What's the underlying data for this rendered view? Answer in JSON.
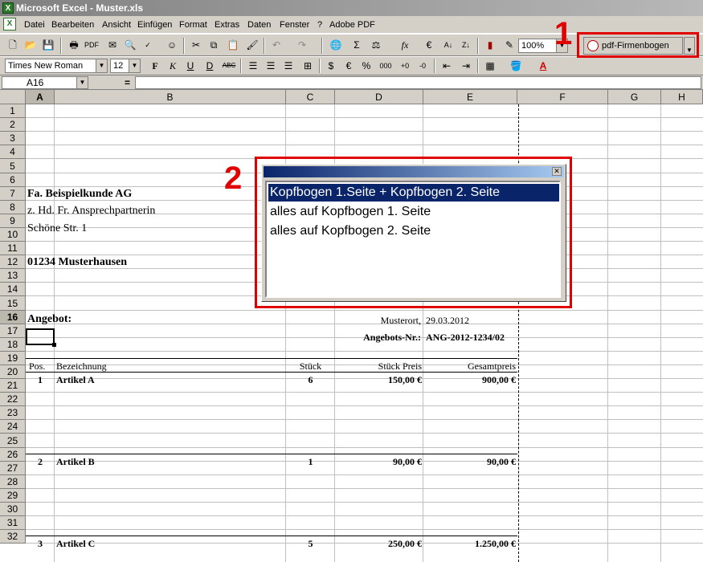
{
  "window": {
    "title": "Microsoft Excel - Muster.xls"
  },
  "menu": [
    "Datei",
    "Bearbeiten",
    "Ansicht",
    "Einfügen",
    "Format",
    "Extras",
    "Daten",
    "Fenster",
    "?",
    "Adobe PDF"
  ],
  "toolbar1": {
    "zoom": "100%",
    "pdf_button": "pdf-Firmenbogen"
  },
  "toolbar2": {
    "font": "Times New Roman",
    "size": "12"
  },
  "formula": {
    "namebox": "A16",
    "fx": "="
  },
  "columns": [
    "A",
    "B",
    "C",
    "D",
    "E",
    "F",
    "G",
    "H"
  ],
  "rows": [
    "1",
    "2",
    "3",
    "4",
    "5",
    "6",
    "7",
    "8",
    "9",
    "10",
    "11",
    "12",
    "13",
    "14",
    "15",
    "16",
    "17",
    "18",
    "19",
    "20",
    "21",
    "22",
    "23",
    "24",
    "25",
    "26",
    "27",
    "28",
    "29",
    "30",
    "31",
    "32"
  ],
  "sheet": {
    "customer_name": "Fa. Beispielkunde AG",
    "attention": "z. Hd. Fr. Ansprechpartnerin",
    "street": "Schöne Str. 1",
    "city": "01234 Musterhausen",
    "offer_heading": "Angebot:",
    "place_date": "Musterort,",
    "date": "29.03.2012",
    "offer_no_label": "Angebots-Nr.:",
    "offer_no": "ANG-2012-1234/02",
    "headers": {
      "pos": "Pos.",
      "desc": "Bezeichnung",
      "qty": "Stück",
      "unit": "Stück Preis",
      "total": "Gesamtpreis"
    },
    "items": [
      {
        "pos": "1",
        "desc": "Artikel A",
        "qty": "6",
        "unit": "150,00 €",
        "total": "900,00 €"
      },
      {
        "pos": "2",
        "desc": "Artikel B",
        "qty": "1",
        "unit": "90,00 €",
        "total": "90,00 €"
      },
      {
        "pos": "3",
        "desc": "Artikel C",
        "qty": "5",
        "unit": "250,00 €",
        "total": "1.250,00 €"
      }
    ]
  },
  "dialog": {
    "options": [
      "Kopfbogen 1.Seite + Kopfbogen 2. Seite",
      "alles auf Kopfbogen 1. Seite",
      "alles auf Kopfbogen 2. Seite"
    ]
  },
  "markers": {
    "m1": "1",
    "m2": "2"
  },
  "colors": {
    "highlight": "#e00000",
    "selection": "#0a246a"
  }
}
